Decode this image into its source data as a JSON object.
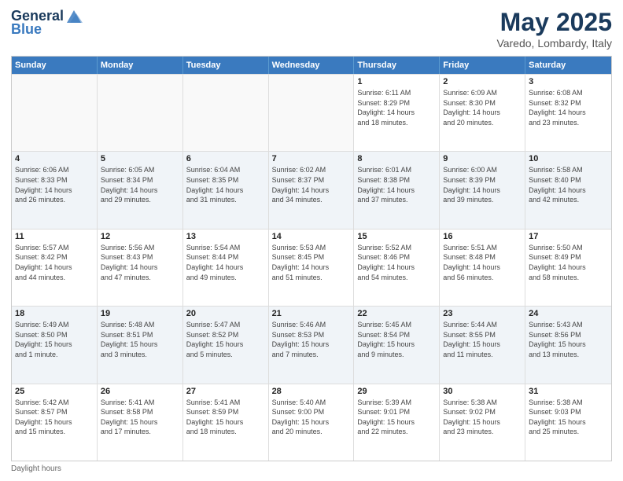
{
  "logo": {
    "general": "General",
    "blue": "Blue"
  },
  "title": "May 2025",
  "subtitle": "Varedo, Lombardy, Italy",
  "header_days": [
    "Sunday",
    "Monday",
    "Tuesday",
    "Wednesday",
    "Thursday",
    "Friday",
    "Saturday"
  ],
  "rows": [
    [
      {
        "day": "",
        "empty": true
      },
      {
        "day": "",
        "empty": true
      },
      {
        "day": "",
        "empty": true
      },
      {
        "day": "",
        "empty": true
      },
      {
        "day": "1",
        "info": "Sunrise: 6:11 AM\nSunset: 8:29 PM\nDaylight: 14 hours\nand 18 minutes."
      },
      {
        "day": "2",
        "info": "Sunrise: 6:09 AM\nSunset: 8:30 PM\nDaylight: 14 hours\nand 20 minutes."
      },
      {
        "day": "3",
        "info": "Sunrise: 6:08 AM\nSunset: 8:32 PM\nDaylight: 14 hours\nand 23 minutes."
      }
    ],
    [
      {
        "day": "4",
        "info": "Sunrise: 6:06 AM\nSunset: 8:33 PM\nDaylight: 14 hours\nand 26 minutes."
      },
      {
        "day": "5",
        "info": "Sunrise: 6:05 AM\nSunset: 8:34 PM\nDaylight: 14 hours\nand 29 minutes."
      },
      {
        "day": "6",
        "info": "Sunrise: 6:04 AM\nSunset: 8:35 PM\nDaylight: 14 hours\nand 31 minutes."
      },
      {
        "day": "7",
        "info": "Sunrise: 6:02 AM\nSunset: 8:37 PM\nDaylight: 14 hours\nand 34 minutes."
      },
      {
        "day": "8",
        "info": "Sunrise: 6:01 AM\nSunset: 8:38 PM\nDaylight: 14 hours\nand 37 minutes."
      },
      {
        "day": "9",
        "info": "Sunrise: 6:00 AM\nSunset: 8:39 PM\nDaylight: 14 hours\nand 39 minutes."
      },
      {
        "day": "10",
        "info": "Sunrise: 5:58 AM\nSunset: 8:40 PM\nDaylight: 14 hours\nand 42 minutes."
      }
    ],
    [
      {
        "day": "11",
        "info": "Sunrise: 5:57 AM\nSunset: 8:42 PM\nDaylight: 14 hours\nand 44 minutes."
      },
      {
        "day": "12",
        "info": "Sunrise: 5:56 AM\nSunset: 8:43 PM\nDaylight: 14 hours\nand 47 minutes."
      },
      {
        "day": "13",
        "info": "Sunrise: 5:54 AM\nSunset: 8:44 PM\nDaylight: 14 hours\nand 49 minutes."
      },
      {
        "day": "14",
        "info": "Sunrise: 5:53 AM\nSunset: 8:45 PM\nDaylight: 14 hours\nand 51 minutes."
      },
      {
        "day": "15",
        "info": "Sunrise: 5:52 AM\nSunset: 8:46 PM\nDaylight: 14 hours\nand 54 minutes."
      },
      {
        "day": "16",
        "info": "Sunrise: 5:51 AM\nSunset: 8:48 PM\nDaylight: 14 hours\nand 56 minutes."
      },
      {
        "day": "17",
        "info": "Sunrise: 5:50 AM\nSunset: 8:49 PM\nDaylight: 14 hours\nand 58 minutes."
      }
    ],
    [
      {
        "day": "18",
        "info": "Sunrise: 5:49 AM\nSunset: 8:50 PM\nDaylight: 15 hours\nand 1 minute."
      },
      {
        "day": "19",
        "info": "Sunrise: 5:48 AM\nSunset: 8:51 PM\nDaylight: 15 hours\nand 3 minutes."
      },
      {
        "day": "20",
        "info": "Sunrise: 5:47 AM\nSunset: 8:52 PM\nDaylight: 15 hours\nand 5 minutes."
      },
      {
        "day": "21",
        "info": "Sunrise: 5:46 AM\nSunset: 8:53 PM\nDaylight: 15 hours\nand 7 minutes."
      },
      {
        "day": "22",
        "info": "Sunrise: 5:45 AM\nSunset: 8:54 PM\nDaylight: 15 hours\nand 9 minutes."
      },
      {
        "day": "23",
        "info": "Sunrise: 5:44 AM\nSunset: 8:55 PM\nDaylight: 15 hours\nand 11 minutes."
      },
      {
        "day": "24",
        "info": "Sunrise: 5:43 AM\nSunset: 8:56 PM\nDaylight: 15 hours\nand 13 minutes."
      }
    ],
    [
      {
        "day": "25",
        "info": "Sunrise: 5:42 AM\nSunset: 8:57 PM\nDaylight: 15 hours\nand 15 minutes."
      },
      {
        "day": "26",
        "info": "Sunrise: 5:41 AM\nSunset: 8:58 PM\nDaylight: 15 hours\nand 17 minutes."
      },
      {
        "day": "27",
        "info": "Sunrise: 5:41 AM\nSunset: 8:59 PM\nDaylight: 15 hours\nand 18 minutes."
      },
      {
        "day": "28",
        "info": "Sunrise: 5:40 AM\nSunset: 9:00 PM\nDaylight: 15 hours\nand 20 minutes."
      },
      {
        "day": "29",
        "info": "Sunrise: 5:39 AM\nSunset: 9:01 PM\nDaylight: 15 hours\nand 22 minutes."
      },
      {
        "day": "30",
        "info": "Sunrise: 5:38 AM\nSunset: 9:02 PM\nDaylight: 15 hours\nand 23 minutes."
      },
      {
        "day": "31",
        "info": "Sunrise: 5:38 AM\nSunset: 9:03 PM\nDaylight: 15 hours\nand 25 minutes."
      }
    ]
  ],
  "footer": "Daylight hours"
}
